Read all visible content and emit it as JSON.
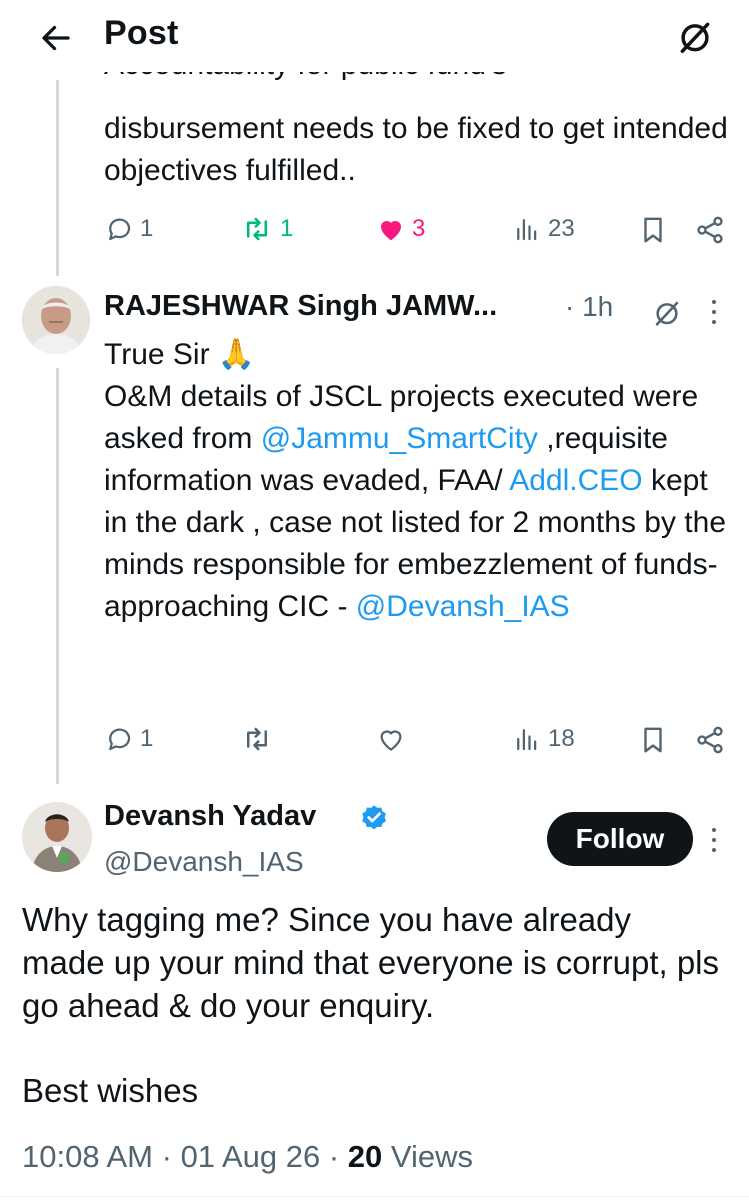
{
  "header": {
    "title": "Post",
    "back_icon": "arrow-left-icon",
    "grok_icon": "grok-icon"
  },
  "parent_tweet": {
    "partial_line": "Accountability for public fund's",
    "text": "disbursement needs to be fixed to get intended objectives fulfilled..",
    "stats": {
      "replies": "1",
      "reposts": "1",
      "likes": "3",
      "views": "23"
    },
    "colors": {
      "repost_active": "#00ba7c",
      "like_active": "#f91880"
    }
  },
  "reply_tweet": {
    "author_name": "RAJESHWAR Singh JAMW...",
    "time": "1h",
    "text_line1": "True Sir 🙏",
    "text_seg1": "O&M details of JSCL projects executed were asked from ",
    "mention1": "@Jammu_SmartCity",
    "text_seg2": " ,requisite information was evaded, FAA/ ",
    "link1": "Addl.CEO",
    "text_seg3": " kept in the dark , case not listed for 2 months by the minds responsible for embezzlement of funds- approaching CIC - ",
    "mention2": "@Devansh_IAS",
    "stats": {
      "replies": "1",
      "reposts": "",
      "likes": "",
      "views": "18"
    }
  },
  "main_tweet": {
    "author_name": "Devansh Yadav",
    "handle": "@Devansh_IAS",
    "verified": true,
    "follow_label": "Follow",
    "text": "Why tagging me? Since you have already made up your mind that everyone is corrupt, pls go ahead & do your enquiry.",
    "sign_off": "Best wishes",
    "time": "10:08 AM",
    "date": "01 Aug 26",
    "views_count": "20",
    "views_label": "Views",
    "separator": "·"
  },
  "colors": {
    "accent": "#1d9bf0",
    "text": "#0f1419",
    "muted": "#536471"
  }
}
